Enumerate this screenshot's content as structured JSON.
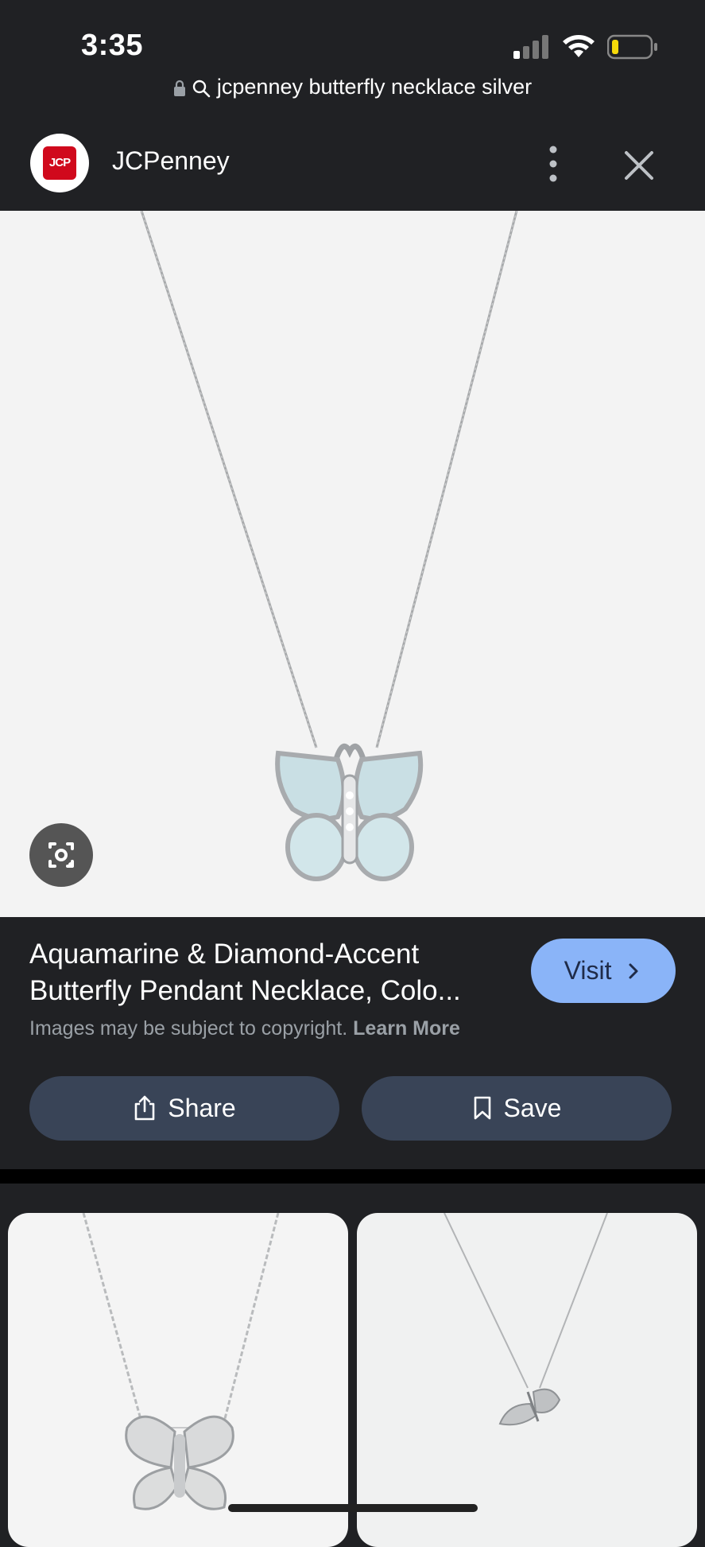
{
  "status": {
    "time": "3:35",
    "url": "jcpenney butterfly necklace silver"
  },
  "source": {
    "logo_text": "JCP",
    "name": "JCPenney"
  },
  "product": {
    "title": "Aquamarine & Diamond-Accent Butterfly Pendant Necklace, Colo...",
    "visit_label": "Visit",
    "copyright_text": "Images may be subject to copyright.",
    "learn_more": "Learn More"
  },
  "actions": {
    "share_label": "Share",
    "save_label": "Save"
  },
  "colors": {
    "background": "#202124",
    "visit_button": "#8ab4f8",
    "action_button": "#394457",
    "brand_red": "#d0091c"
  },
  "icons": [
    "lock-icon",
    "search-icon",
    "more-vert-icon",
    "close-icon",
    "lens-icon",
    "share-icon",
    "bookmark-icon",
    "chevron-right-icon"
  ]
}
